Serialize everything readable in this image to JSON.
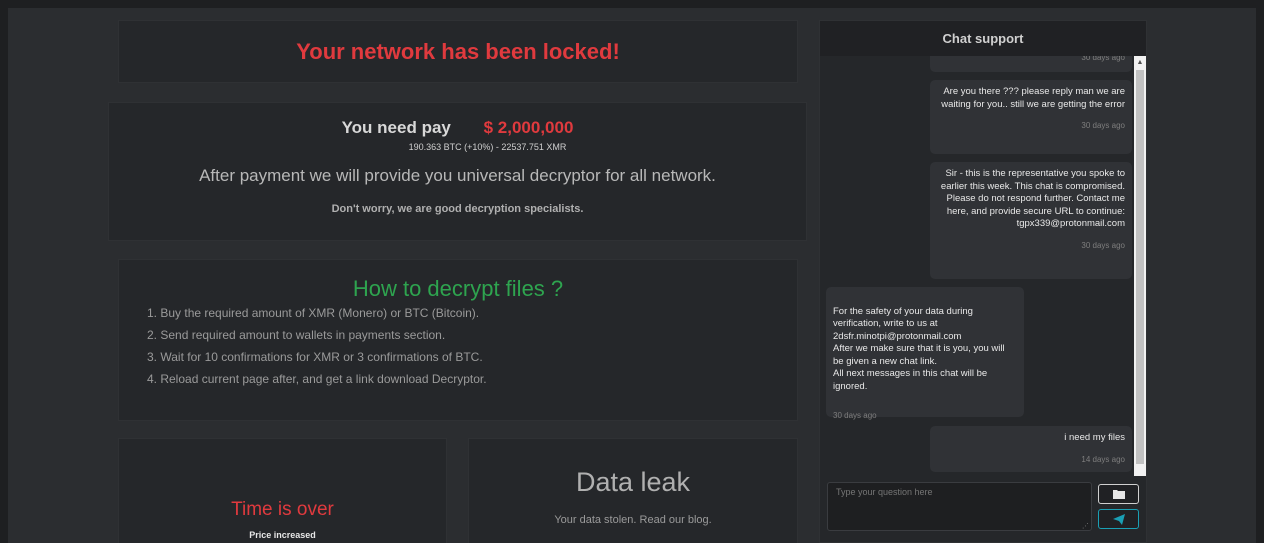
{
  "header": {
    "title": "Your network has been locked!"
  },
  "payment": {
    "label": "You need pay",
    "amount": "$ 2,000,000",
    "crypto_line": "190.363 BTC (+10%) - 22537.751 XMR",
    "after_payment": "After payment we will provide you universal decryptor for all network.",
    "reassurance": "Don't worry, we are good decryption specialists."
  },
  "howto": {
    "title": "How to decrypt files ?",
    "steps": [
      "1. Buy the required amount of XMR (Monero) or BTC (Bitcoin).",
      "2. Send required amount to wallets in payments section.",
      "3. Wait for 10 confirmations for XMR or 3 confirmations of BTC.",
      "4. Reload current page after, and get a link download Decryptor."
    ]
  },
  "timer": {
    "status": "Time is over",
    "note": "Price increased"
  },
  "leak": {
    "title": "Data leak",
    "subtitle": "Your data stolen. Read our blog."
  },
  "chat": {
    "title": "Chat support",
    "messages": [
      {
        "side": "right",
        "text": "",
        "time": "30 days ago"
      },
      {
        "side": "right",
        "text": "Are you there ??? please reply man we are waiting for you.. still we are getting the error",
        "time": "30 days ago"
      },
      {
        "side": "right",
        "text": "Sir - this is the representative you spoke to earlier this week. This chat is compromised. Please do not respond further. Contact me here, and provide secure URL to continue: tgpx339@protonmail.com",
        "time": "30 days ago"
      },
      {
        "side": "left",
        "text": "For the safety of your data during verification, write to us at 2dsfr.minotpi@protonmail.com\nAfter we make sure that it is you, you will be given a new chat link.\nAll next messages in this chat will be ignored.",
        "time": "30 days ago"
      },
      {
        "side": "right",
        "text": "i need my files",
        "time": "14 days ago"
      }
    ],
    "input_placeholder": "Type your question here"
  },
  "icons": {
    "attach": "folder-icon",
    "send": "paper-plane-icon"
  },
  "colors": {
    "alert": "#e03a3e",
    "success": "#2ea44f",
    "send_accent": "#1aa0b5"
  }
}
